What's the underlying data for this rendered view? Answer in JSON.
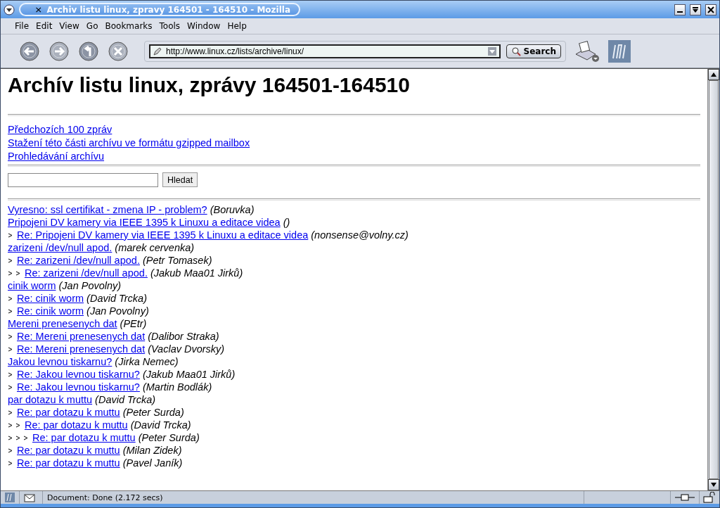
{
  "window": {
    "title": "Archiv listu linux, zpravy 164501 - 164510 - Mozilla"
  },
  "menu": [
    "File",
    "Edit",
    "View",
    "Go",
    "Bookmarks",
    "Tools",
    "Window",
    "Help"
  ],
  "toolbar": {
    "url": "http://www.linux.cz/lists/archive/linux/",
    "search_button": "Search"
  },
  "page": {
    "heading": "Archív listu linux, zprávy 164501-164510",
    "links": [
      "Předchozích 100 zpráv",
      "Stažení této části archívu ve formátu gzipped mailbox",
      "Prohledávání archívu"
    ],
    "search_button": "Hledat",
    "threads": [
      {
        "subject": "Vyresno: ssl certifikat - zmena IP - problem?",
        "author": "(Boruvka)"
      },
      {
        "subject": "Pripojeni DV kamery via IEEE 1395 k Linuxu a editace videa",
        "author": "()",
        "children": [
          {
            "subject": "Re: Pripojeni DV kamery via IEEE 1395 k Linuxu a editace videa",
            "author": "(nonsense@volny.cz)"
          }
        ]
      },
      {
        "subject": "zarizeni /dev/null apod.",
        "author": "(marek cervenka)",
        "children": [
          {
            "subject": "Re: zarizeni /dev/null apod.",
            "author": "(Petr Tomasek)",
            "children": [
              {
                "subject": "Re: zarizeni /dev/null apod.",
                "author": "(Jakub Maa01 Jirků)"
              }
            ]
          }
        ]
      },
      {
        "subject": "cinik worm",
        "author": "(Jan Povolny)",
        "children": [
          {
            "subject": "Re: cinik worm",
            "author": "(David Trcka)"
          },
          {
            "subject": "Re: cinik worm",
            "author": "(Jan Povolny)"
          }
        ]
      },
      {
        "subject": "Mereni prenesenych dat",
        "author": "(PEtr)",
        "children": [
          {
            "subject": "Re: Mereni prenesenych dat",
            "author": "(Dalibor Straka)"
          },
          {
            "subject": "Re: Mereni prenesenych dat",
            "author": "(Vaclav Dvorsky)"
          }
        ]
      },
      {
        "subject": "Jakou levnou tiskarnu?",
        "author": "(Jirka Nemec)",
        "children": [
          {
            "subject": "Re: Jakou levnou tiskarnu?",
            "author": "(Jakub Maa01 Jirků)"
          },
          {
            "subject": "Re: Jakou levnou tiskarnu?",
            "author": "(Martin Bodlák)"
          }
        ]
      },
      {
        "subject": "par dotazu k muttu",
        "author": "(David Trcka)",
        "children": [
          {
            "subject": "Re: par dotazu k muttu",
            "author": "(Peter Surda)",
            "children": [
              {
                "subject": "Re: par dotazu k muttu",
                "author": "(David Trcka)",
                "children": [
                  {
                    "subject": "Re: par dotazu k muttu",
                    "author": "(Peter Surda)"
                  }
                ]
              }
            ]
          },
          {
            "subject": "Re: par dotazu k muttu",
            "author": "(Milan Zidek)"
          },
          {
            "subject": "Re: par dotazu k muttu",
            "author": "(Pavel Janík)"
          }
        ]
      }
    ]
  },
  "status_bar": {
    "text": "Document: Done (2.172 secs)"
  }
}
